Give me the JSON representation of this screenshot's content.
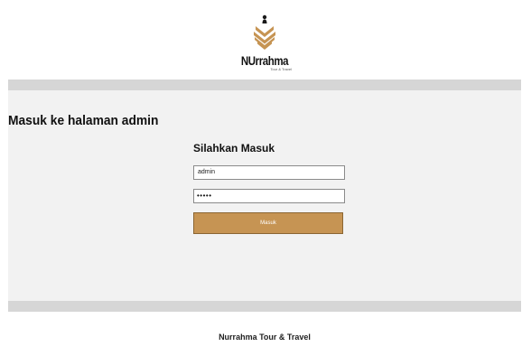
{
  "header": {
    "brand_name": "NUrrahma",
    "brand_tagline": "Tour & Travel"
  },
  "main": {
    "title": "Masuk ke halaman admin",
    "form": {
      "heading": "Silahkan Masuk",
      "username_value": "admin",
      "password_mask": "•••••",
      "submit_label": "Masuk"
    }
  },
  "footer": {
    "text": "Nurrahma Tour & Travel"
  },
  "colors": {
    "accent": "#c69453",
    "page_bg": "#f2f2f2",
    "divider": "#d6d6d6"
  },
  "icons": {
    "logo": "nurrahma-logo"
  }
}
